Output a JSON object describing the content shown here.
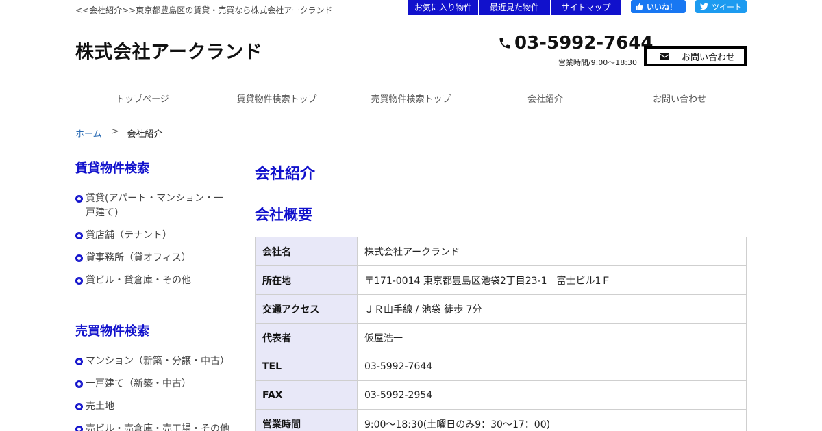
{
  "header": {
    "description": "<<会社紹介>>東京都豊島区の賃貸・売買なら株式会社アークランド",
    "top_links": [
      {
        "label": "お気に入り物件"
      },
      {
        "label": "最近見た物件"
      },
      {
        "label": "サイトマップ"
      }
    ],
    "facebook_label": "いいね！",
    "twitter_label": "ツイート",
    "logo": "株式会社アークランド",
    "phone": "03-5992-7644",
    "hours": "営業時間/9:00～18:30",
    "contact_button": "お問い合わせ"
  },
  "main_nav": [
    {
      "label": "トップページ"
    },
    {
      "label": "賃貸物件検索トップ"
    },
    {
      "label": "売買物件検索トップ"
    },
    {
      "label": "会社紹介"
    },
    {
      "label": "お問い合わせ"
    }
  ],
  "breadcrumb": {
    "home": "ホーム",
    "separator": ">",
    "current": "会社紹介"
  },
  "sidebar": {
    "rental": {
      "heading": "賃貸物件検索",
      "items": [
        {
          "label": "賃貸(アパート・マンション・一戸建て)"
        },
        {
          "label": "貸店舗（テナント）"
        },
        {
          "label": "貸事務所（貸オフィス）"
        },
        {
          "label": "貸ビル・貸倉庫・その他"
        }
      ]
    },
    "sale": {
      "heading": "売買物件検索",
      "items": [
        {
          "label": "マンション（新築・分譲・中古）"
        },
        {
          "label": "一戸建て（新築・中古）"
        },
        {
          "label": "売土地"
        },
        {
          "label": "売ビル・売倉庫・売工場・その他"
        }
      ]
    }
  },
  "content": {
    "page_title": "会社紹介",
    "section_title": "会社概要",
    "rows": [
      {
        "label": "会社名",
        "value": "株式会社アークランド"
      },
      {
        "label": "所在地",
        "value": "〒171-0014 東京都豊島区池袋2丁目23-1　富士ビル1Ｆ"
      },
      {
        "label": "交通アクセス",
        "value": "ＪＲ山手線 / 池袋 徒歩 7分"
      },
      {
        "label": "代表者",
        "value": "仮屋浩一"
      },
      {
        "label": "TEL",
        "value": "03-5992-7644"
      },
      {
        "label": "FAX",
        "value": "03-5992-2954"
      },
      {
        "label": "営業時間",
        "value": "9:00～18:30(土曜日のみ9：30～17：00)"
      }
    ]
  },
  "colors": {
    "accent": "#1111cc",
    "breadcrumb_link": "#2d6db5",
    "table_label_bg": "#e8e8f8",
    "facebook": "#1877f2",
    "twitter": "#1d9bf0"
  }
}
